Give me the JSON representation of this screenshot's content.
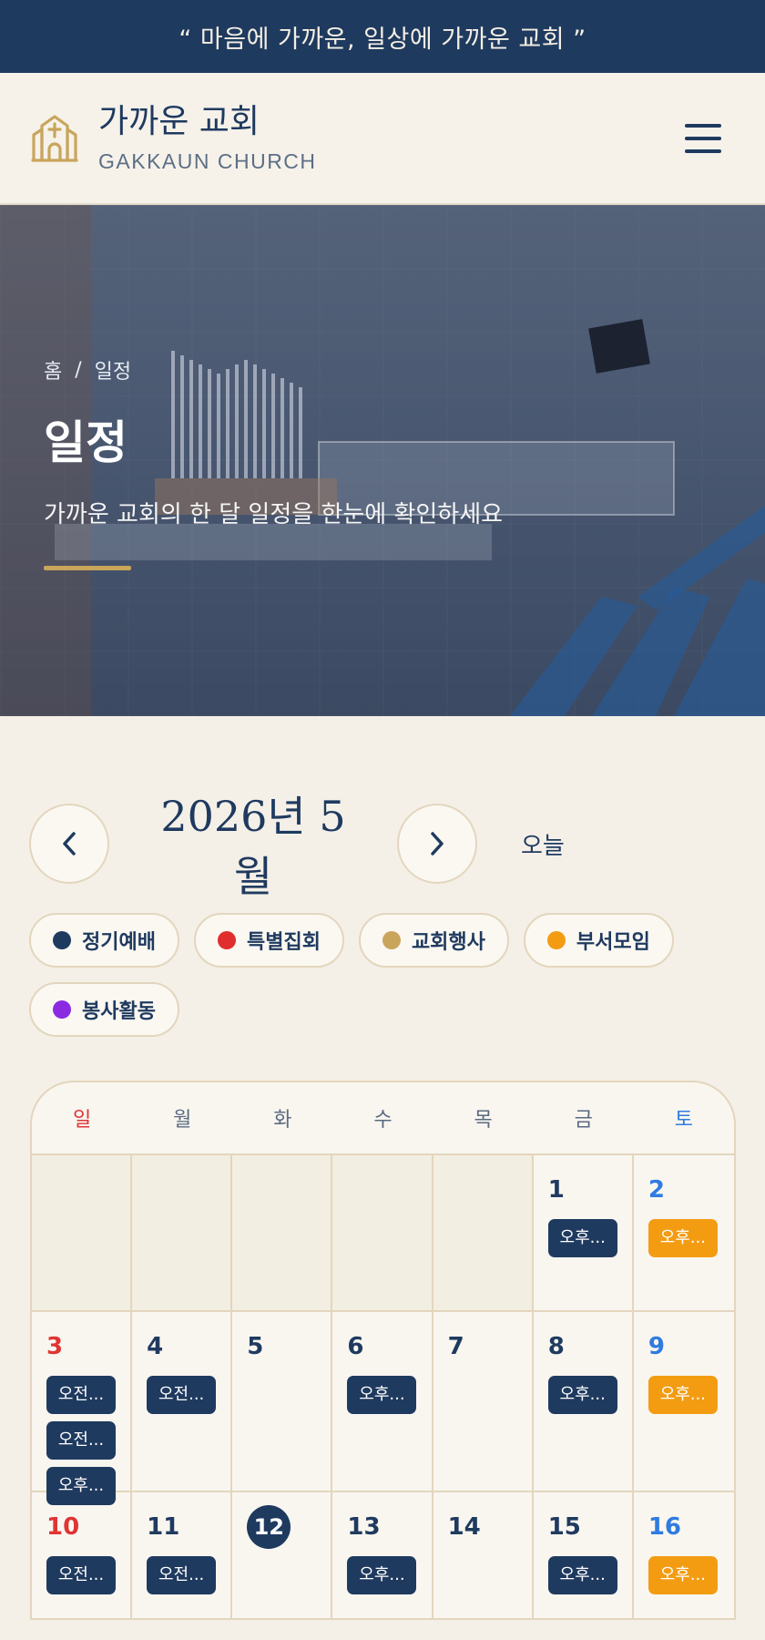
{
  "topbar": {
    "quote": "“ 마음에 가까운, 일상에 가까운 교회 ”"
  },
  "header": {
    "name_kr": "가까운 교회",
    "name_en": "GAKKAUN CHURCH"
  },
  "hero": {
    "breadcrumb": {
      "home": "홈",
      "separator": "/",
      "current": "일정"
    },
    "title": "일정",
    "subtitle": "가까운 교회의 한 달 일정을 한눈에 확인하세요"
  },
  "calendar_controls": {
    "month_label": "2026년 5월",
    "today_label": "오늘"
  },
  "legend": [
    {
      "label": "정기예배",
      "color": "#1f3a5f"
    },
    {
      "label": "특별집회",
      "color": "#e02d2d"
    },
    {
      "label": "교회행사",
      "color": "#c9a55c"
    },
    {
      "label": "부서모임",
      "color": "#f39c12"
    },
    {
      "label": "봉사활동",
      "color": "#8a2be2"
    }
  ],
  "weekdays": [
    "일",
    "월",
    "화",
    "수",
    "목",
    "금",
    "토"
  ],
  "weeks": [
    [
      {
        "day": "",
        "events": []
      },
      {
        "day": "",
        "events": []
      },
      {
        "day": "",
        "events": []
      },
      {
        "day": "",
        "events": []
      },
      {
        "day": "",
        "events": []
      },
      {
        "day": "1",
        "events": [
          {
            "label": "오후...",
            "type": "regular"
          }
        ]
      },
      {
        "day": "2",
        "events": [
          {
            "label": "오후...",
            "type": "dept"
          }
        ]
      }
    ],
    [
      {
        "day": "3",
        "events": [
          {
            "label": "오전...",
            "type": "regular"
          },
          {
            "label": "오전...",
            "type": "regular"
          },
          {
            "label": "오후...",
            "type": "regular"
          }
        ]
      },
      {
        "day": "4",
        "events": [
          {
            "label": "오전...",
            "type": "regular"
          }
        ]
      },
      {
        "day": "5",
        "events": []
      },
      {
        "day": "6",
        "events": [
          {
            "label": "오후...",
            "type": "regular"
          }
        ]
      },
      {
        "day": "7",
        "events": []
      },
      {
        "day": "8",
        "events": [
          {
            "label": "오후...",
            "type": "regular"
          }
        ]
      },
      {
        "day": "9",
        "events": [
          {
            "label": "오후...",
            "type": "dept"
          }
        ]
      }
    ],
    [
      {
        "day": "10",
        "events": [
          {
            "label": "오전...",
            "type": "regular"
          }
        ]
      },
      {
        "day": "11",
        "events": [
          {
            "label": "오전...",
            "type": "regular"
          }
        ]
      },
      {
        "day": "12",
        "today": true,
        "events": []
      },
      {
        "day": "13",
        "events": [
          {
            "label": "오후...",
            "type": "regular"
          }
        ]
      },
      {
        "day": "14",
        "events": []
      },
      {
        "day": "15",
        "events": [
          {
            "label": "오후...",
            "type": "regular"
          }
        ]
      },
      {
        "day": "16",
        "events": [
          {
            "label": "오후...",
            "type": "dept"
          }
        ]
      }
    ]
  ],
  "colors": {
    "navy": "#1f3a5f",
    "gold": "#c9a55c",
    "orange": "#f39c12",
    "sunday_red": "#e03434",
    "saturday_blue": "#2f7be0"
  }
}
